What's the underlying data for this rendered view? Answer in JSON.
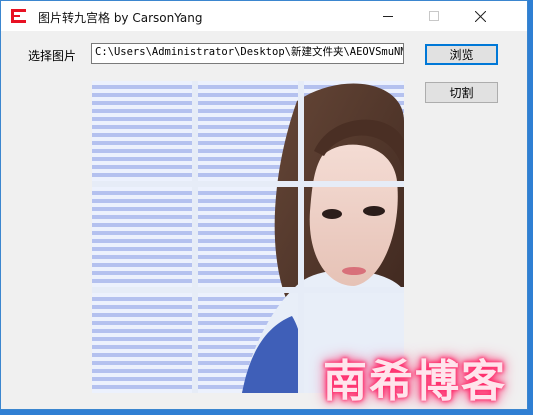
{
  "window": {
    "title": "图片转九宫格 by CarsonYang"
  },
  "controls": {
    "select_label": "选择图片",
    "path_value": "C:\\Users\\Administrator\\Desktop\\新建文件夹\\AEOVSmuNM",
    "browse_label": "浏览",
    "cut_label": "切割"
  },
  "preview": {
    "watermark": "南希博客"
  },
  "colors": {
    "accent": "#0078d7",
    "titlebar": "#ffffff",
    "window_bg": "#f0f0f0",
    "brand_red": "#e81123"
  },
  "icons": [
    "app-icon",
    "minimize-icon",
    "maximize-icon",
    "close-icon"
  ]
}
